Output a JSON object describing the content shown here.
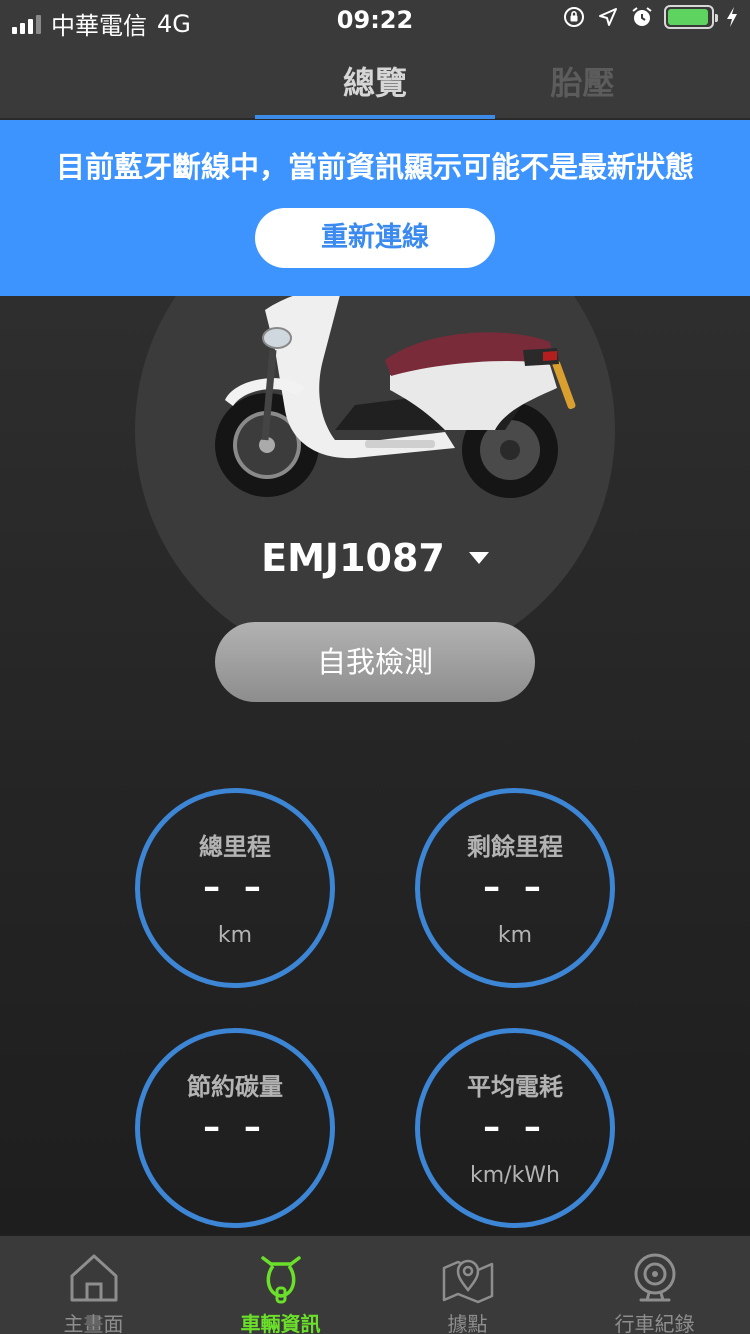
{
  "status_bar": {
    "carrier": "中華電信",
    "network": "4G",
    "time": "09:22",
    "battery_level": 0.95
  },
  "tabs": [
    {
      "label": "總覽",
      "active": true
    },
    {
      "label": "胎壓",
      "active": false
    }
  ],
  "banner": {
    "message": "目前藍牙斷線中，當前資訊顯示可能不是最新狀態",
    "reconnect_label": "重新連線"
  },
  "vehicle": {
    "name": "EMJ1087",
    "self_test_label": "自我檢測"
  },
  "stats": [
    {
      "title": "總里程",
      "value": "– –",
      "unit": "km"
    },
    {
      "title": "剩餘里程",
      "value": "– –",
      "unit": "km"
    },
    {
      "title": "節約碳量",
      "value": "– –",
      "unit": ""
    },
    {
      "title": "平均電耗",
      "value": "– –",
      "unit": "km/kWh"
    }
  ],
  "bottom_nav": [
    {
      "label": "主畫面",
      "icon": "home-icon",
      "active": false
    },
    {
      "label": "車輛資訊",
      "icon": "scooter-icon",
      "active": true
    },
    {
      "label": "據點",
      "icon": "map-pin-icon",
      "active": false
    },
    {
      "label": "行車紀錄",
      "icon": "dashcam-icon",
      "active": false
    }
  ],
  "colors": {
    "accent_blue": "#3d94ff",
    "gauge_ring": "#3d86d6",
    "active_green": "#6be02a"
  }
}
